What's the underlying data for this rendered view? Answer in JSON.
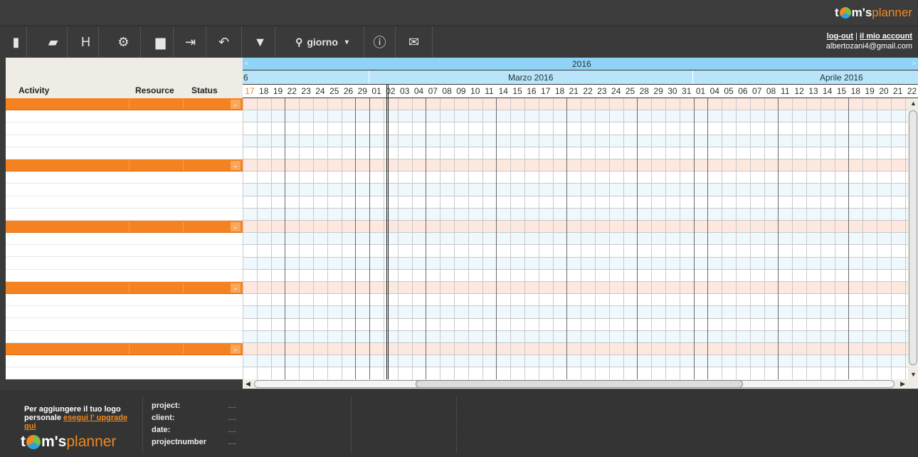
{
  "brand": {
    "prefix": "t",
    "mid": "m's",
    "suffix": "planner"
  },
  "toolbar": {
    "items": [
      {
        "name": "new-icon",
        "glyph": "▮"
      },
      {
        "name": "open-folder-icon",
        "glyph": "▰"
      },
      {
        "name": "save-icon",
        "glyph": "H"
      },
      {
        "name": "settings-icon",
        "glyph": "⚙"
      },
      {
        "name": "print-icon",
        "glyph": "▆"
      },
      {
        "name": "export-icon",
        "glyph": "⇥"
      },
      {
        "name": "undo-icon",
        "glyph": "↶"
      },
      {
        "name": "filter-icon",
        "glyph": "▼"
      }
    ],
    "zoom_label": "giorno",
    "info_glyph": "ⓘ",
    "mail_glyph": "✉"
  },
  "account": {
    "logout": "log-out",
    "sep": " | ",
    "my_account": "il mio account",
    "email": "albertozani4@gmail.com"
  },
  "columns": {
    "activity": "Activity",
    "resource": "Resource",
    "status": "Status"
  },
  "timeline": {
    "year": "2016",
    "months": [
      {
        "label": "6"
      },
      {
        "label": "Marzo 2016"
      },
      {
        "label": "Aprile 2016"
      }
    ],
    "days": [
      "17",
      "18",
      "19",
      "22",
      "23",
      "24",
      "25",
      "26",
      "29",
      "01",
      "02",
      "03",
      "04",
      "07",
      "08",
      "09",
      "10",
      "11",
      "14",
      "15",
      "16",
      "17",
      "18",
      "21",
      "22",
      "23",
      "24",
      "25",
      "28",
      "29",
      "30",
      "31",
      "01",
      "04",
      "05",
      "06",
      "07",
      "08",
      "11",
      "12",
      "13",
      "14",
      "15",
      "18",
      "19",
      "20",
      "21",
      "22"
    ],
    "highlight_day_index": 0,
    "today_index": 10
  },
  "rows": {
    "groups": 5,
    "rows_per_group": 5
  },
  "footer": {
    "promo_text": "Per aggiungere il tuo logo personale ",
    "promo_link": "esegui l' upgrade qui",
    "labels": [
      "project:",
      "client:",
      "date:",
      "projectnumber"
    ],
    "values": [
      "....",
      "....",
      "....",
      "...."
    ]
  },
  "colors": {
    "accent": "#f58220",
    "header_blue": "#8fd3f7",
    "dark": "#3a3a3a"
  }
}
